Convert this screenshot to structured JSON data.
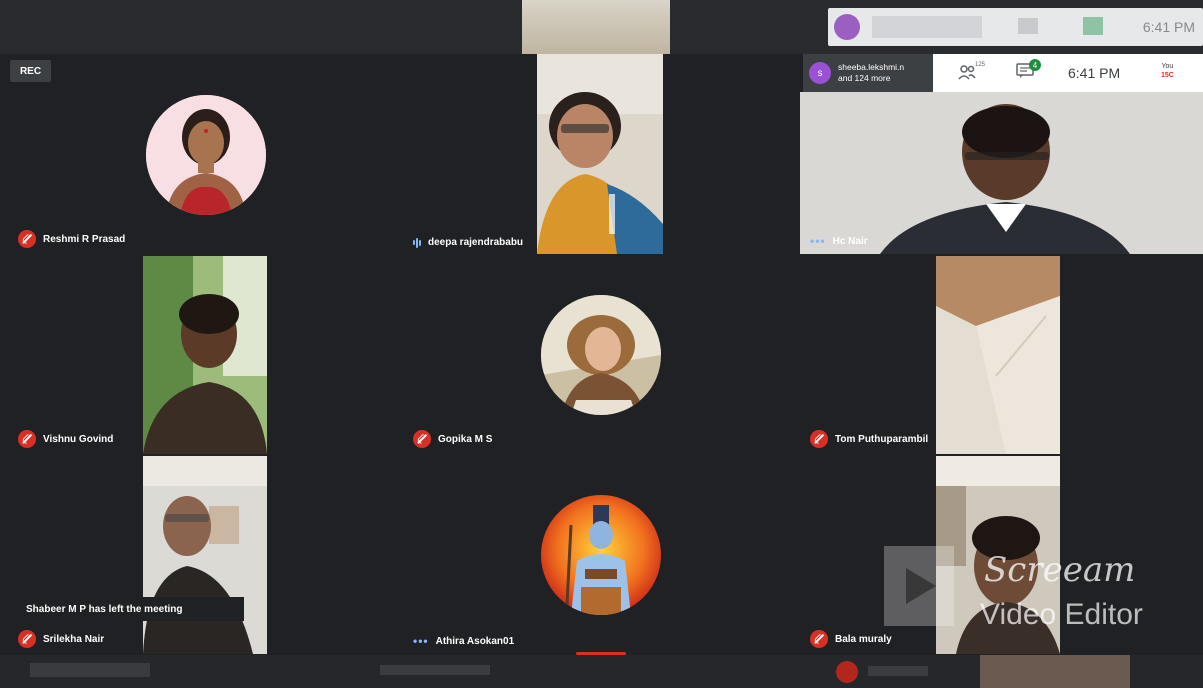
{
  "meeting": {
    "rec_label": "REC",
    "participants_summary_line1": "sheeba.lekshmi.n",
    "participants_summary_line2": "and 124 more",
    "participant_avatar_letter": "s",
    "people_count": "125",
    "chat_badge": "4",
    "time": "6:41 PM",
    "self_label_line1": "You",
    "self_label_line2": "15C"
  },
  "tiles": [
    {
      "name": "Reshmi R Prasad",
      "status": "muted"
    },
    {
      "name": "deepa rajendrababu",
      "status": "speaking"
    },
    {
      "name": "Hc Nair",
      "status": "dots"
    },
    {
      "name": "Vishnu Govind",
      "status": "muted"
    },
    {
      "name": "Gopika M S",
      "status": "muted"
    },
    {
      "name": "Tom Puthuparambil",
      "status": "muted"
    },
    {
      "name": "Srilekha Nair",
      "status": "muted"
    },
    {
      "name": "Athira Asokan01",
      "status": "dots"
    },
    {
      "name": "Bala muraly",
      "status": "muted"
    }
  ],
  "notification": "Shabeer M P has left the meeting",
  "watermark": {
    "brand": "Screeam",
    "subtitle": "Video Editor"
  },
  "colors": {
    "background": "#202124",
    "mic_muted": "#d93025",
    "accent": "#8ab4f8",
    "chat_badge": "#1e8e3e"
  }
}
